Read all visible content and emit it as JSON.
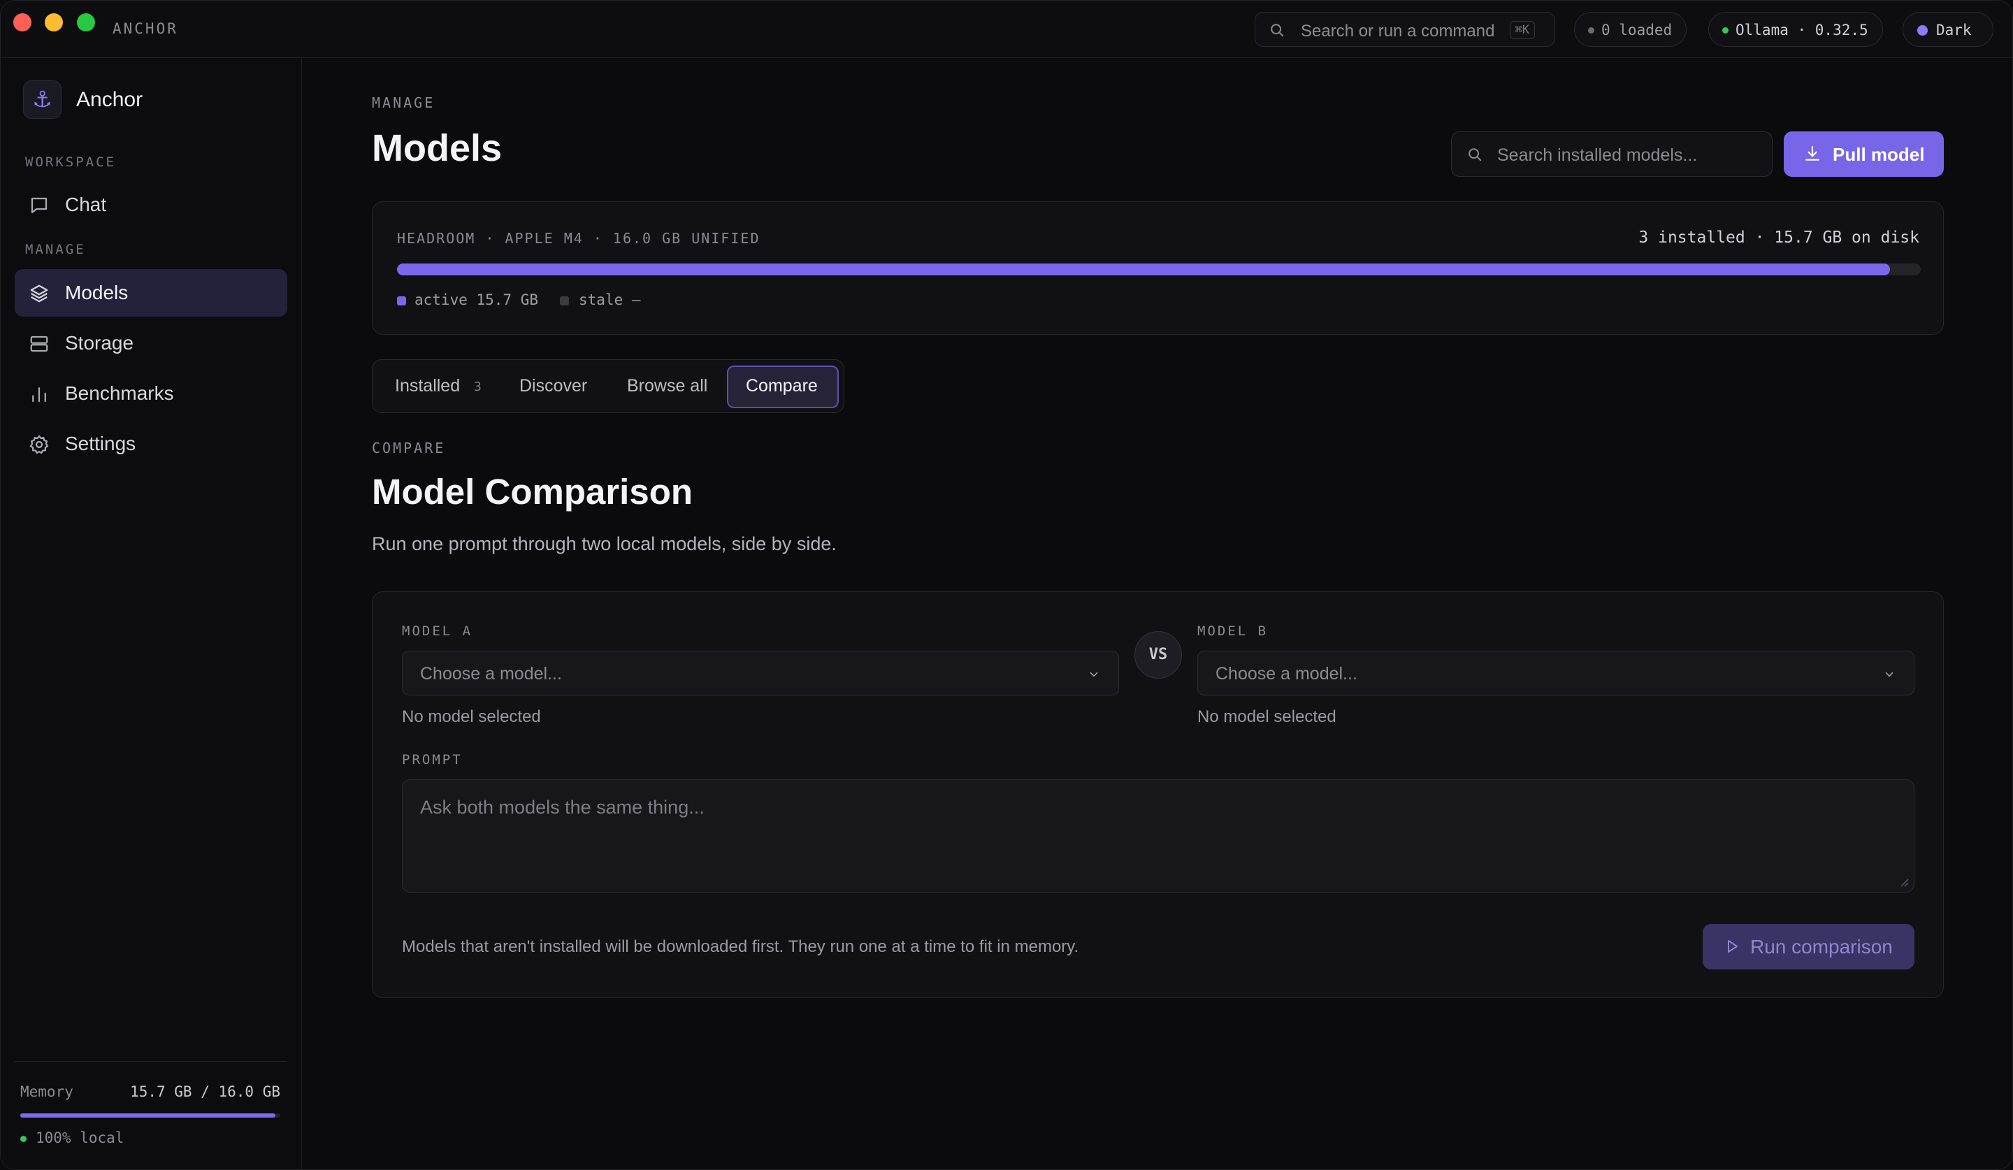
{
  "titlebar": {
    "app_name": "ANCHOR",
    "command_placeholder": "Search or run a command",
    "command_shortcut": "⌘K",
    "loaded_status": "0 loaded",
    "runtime_status": "Ollama · 0.32.5",
    "theme_label": "Dark",
    "colors": {
      "loaded_dot": "#6b6b74",
      "runtime_dot": "#34c759",
      "theme_dot": "#8b7cf6"
    }
  },
  "sidebar": {
    "brand": "Anchor",
    "brand_icon": "anchor-icon",
    "sections": [
      {
        "label": "WORKSPACE",
        "items": [
          {
            "label": "Chat",
            "icon": "chat-icon",
            "active": false
          }
        ]
      },
      {
        "label": "MANAGE",
        "items": [
          {
            "label": "Models",
            "icon": "layers-icon",
            "active": true
          },
          {
            "label": "Storage",
            "icon": "storage-icon",
            "active": false
          },
          {
            "label": "Benchmarks",
            "icon": "bar-chart-icon",
            "active": false
          },
          {
            "label": "Settings",
            "icon": "gear-icon",
            "active": false
          }
        ]
      }
    ],
    "memory": {
      "label": "Memory",
      "value": "15.7 GB / 16.0 GB",
      "used_fraction": 0.98
    },
    "local_status": "100% local"
  },
  "main": {
    "eyebrow": "MANAGE",
    "title": "Models",
    "search_placeholder": "Search installed models...",
    "pull_button": "Pull model",
    "headroom": {
      "label": "HEADROOM · APPLE M4 · 16.0 GB UNIFIED",
      "summary": "3 installed · 15.7 GB on disk",
      "used_fraction": 0.98,
      "legend": [
        {
          "label": "active 15.7 GB",
          "color": "#7a68ec"
        },
        {
          "label": "stale —",
          "color": "#3a3a40"
        }
      ]
    },
    "tabs": [
      {
        "label": "Installed",
        "count": "3",
        "active": false
      },
      {
        "label": "Discover",
        "active": false
      },
      {
        "label": "Browse all",
        "active": false
      },
      {
        "label": "Compare",
        "active": true
      }
    ],
    "compare": {
      "eyebrow": "COMPARE",
      "title": "Model Comparison",
      "subtitle": "Run one prompt through two local models, side by side.",
      "model_a": {
        "label": "MODEL A",
        "placeholder": "Choose a model...",
        "status": "No model selected"
      },
      "vs": "VS",
      "model_b": {
        "label": "MODEL B",
        "placeholder": "Choose a model...",
        "status": "No model selected"
      },
      "prompt_label": "PROMPT",
      "prompt_placeholder": "Ask both models the same thing...",
      "hint": "Models that aren't installed will be downloaded first. They run one at a time to fit in memory.",
      "run_button": "Run comparison"
    },
    "accent": "#7866e8"
  }
}
